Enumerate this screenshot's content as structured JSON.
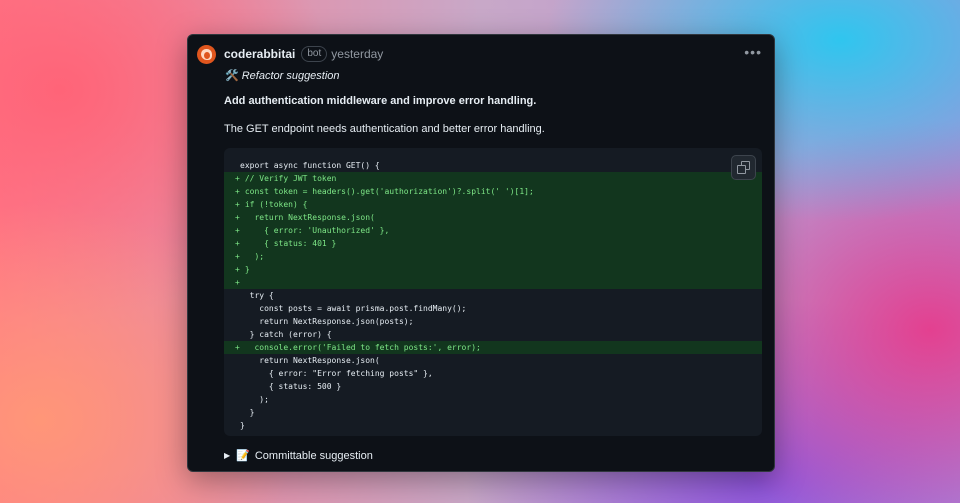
{
  "comment": {
    "author": "coderabbitai",
    "badge": "bot",
    "timestamp": "yesterday",
    "more_icon": "•••",
    "suggestion_emoji": "🛠️",
    "suggestion_title": "Refactor suggestion",
    "headline": "Add authentication middleware and improve error handling.",
    "description": "The GET endpoint needs authentication and better error handling.",
    "code_lines": [
      {
        "text": "export async function GET() {",
        "added": false
      },
      {
        "text": " // Verify JWT token",
        "added": true
      },
      {
        "text": " const token = headers().get('authorization')?.split(' ')[1];",
        "added": true
      },
      {
        "text": " if (!token) {",
        "added": true
      },
      {
        "text": "   return NextResponse.json(",
        "added": true
      },
      {
        "text": "     { error: 'Unauthorized' },",
        "added": true
      },
      {
        "text": "     { status: 401 }",
        "added": true
      },
      {
        "text": "   );",
        "added": true
      },
      {
        "text": " }",
        "added": true
      },
      {
        "text": "",
        "added": true
      },
      {
        "text": "  try {",
        "added": false
      },
      {
        "text": "    const posts = await prisma.post.findMany();",
        "added": false
      },
      {
        "text": "    return NextResponse.json(posts);",
        "added": false
      },
      {
        "text": "  } catch (error) {",
        "added": false
      },
      {
        "text": "   console.error('Failed to fetch posts:', error);",
        "added": true
      },
      {
        "text": "    return NextResponse.json(",
        "added": false
      },
      {
        "text": "      { error: \"Error fetching posts\" },",
        "added": false
      },
      {
        "text": "      { status: 500 }",
        "added": false
      },
      {
        "text": "    );",
        "added": false
      },
      {
        "text": "  }",
        "added": false
      },
      {
        "text": "}",
        "added": false
      }
    ],
    "footer_triangle": "▶",
    "footer_emoji": "📝",
    "footer_label": "Committable suggestion"
  }
}
